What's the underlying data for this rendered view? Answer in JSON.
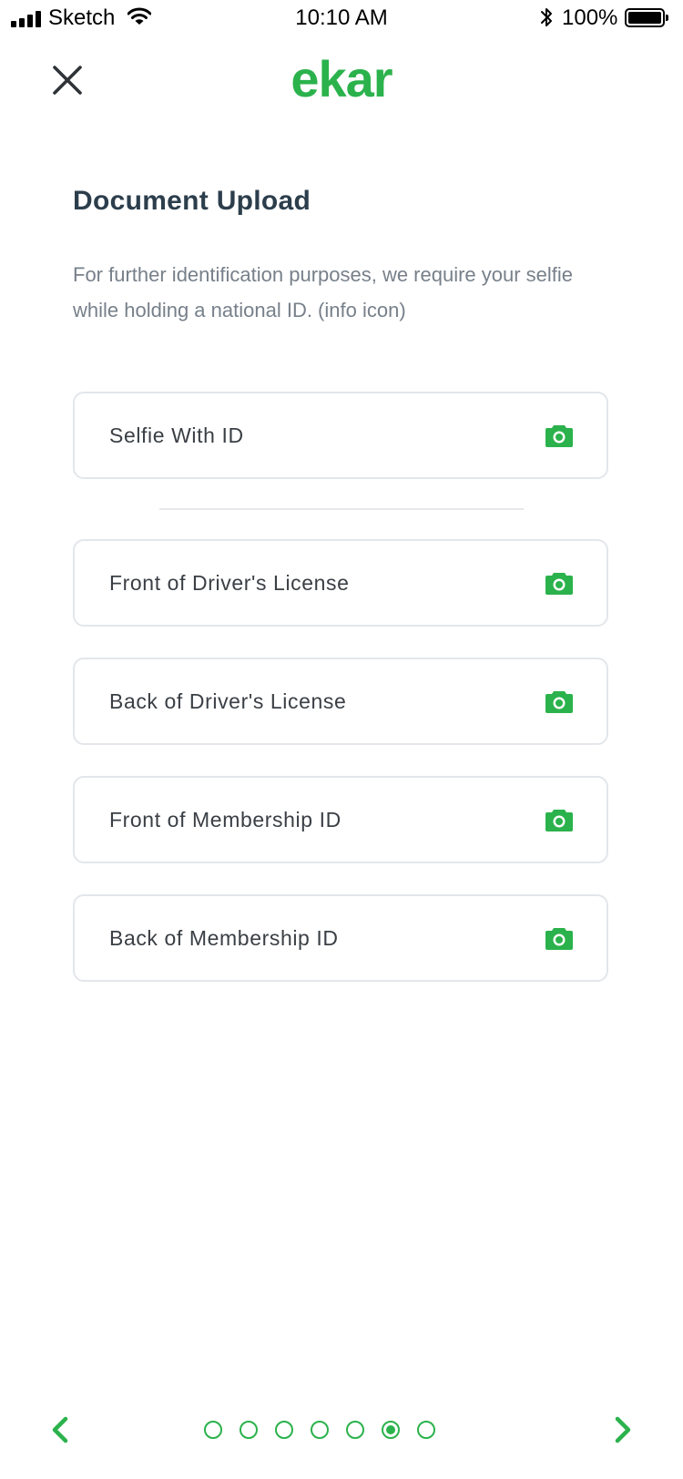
{
  "status_bar": {
    "carrier": "Sketch",
    "time": "10:10 AM",
    "battery": "100%"
  },
  "header": {
    "logo_text": "ekar",
    "close_icon": "close-icon"
  },
  "page": {
    "title": "Document Upload",
    "description": "For further identification purposes, we require your selfie while holding a national ID. (info icon)"
  },
  "documents": [
    {
      "label": "Selfie With ID",
      "icon": "camera-icon"
    },
    {
      "label": "Front of Driver's License",
      "icon": "camera-icon"
    },
    {
      "label": "Back of Driver's License",
      "icon": "camera-icon"
    },
    {
      "label": "Front of Membership ID",
      "icon": "camera-icon"
    },
    {
      "label": "Back of Membership ID",
      "icon": "camera-icon"
    }
  ],
  "pager": {
    "total": 7,
    "current": 6
  },
  "colors": {
    "brand": "#2bb24c",
    "title": "#2c3e4c",
    "body_text": "#77808a",
    "border": "#e3e6ea"
  }
}
